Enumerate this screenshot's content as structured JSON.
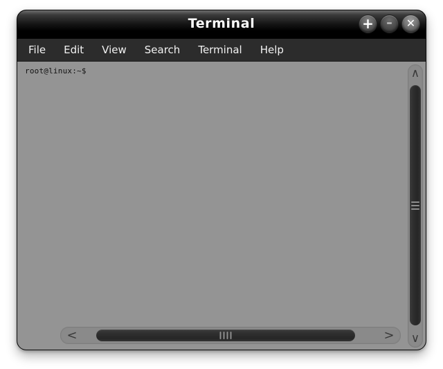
{
  "window": {
    "title": "Terminal",
    "controls": [
      {
        "name": "maximize-button",
        "glyph": "+",
        "label": "Maximize"
      },
      {
        "name": "minimize-button",
        "glyph": "–",
        "label": "Minimize"
      },
      {
        "name": "close-button",
        "glyph": "✕",
        "label": "Close"
      }
    ]
  },
  "menubar": {
    "items": [
      {
        "label": "File"
      },
      {
        "label": "Edit"
      },
      {
        "label": "View"
      },
      {
        "label": "Search"
      },
      {
        "label": "Terminal"
      },
      {
        "label": "Help"
      }
    ]
  },
  "terminal": {
    "background_color": "#949494",
    "text_color": "#111111",
    "lines": [
      "root@linux:~$"
    ]
  },
  "scrollbars": {
    "vertical": {
      "up_arrow_glyph": "∧",
      "down_arrow_glyph": "∨",
      "grip_line_count": 3
    },
    "horizontal": {
      "left_arrow_glyph": "<",
      "right_arrow_glyph": ">",
      "grip_line_count": 4
    }
  }
}
